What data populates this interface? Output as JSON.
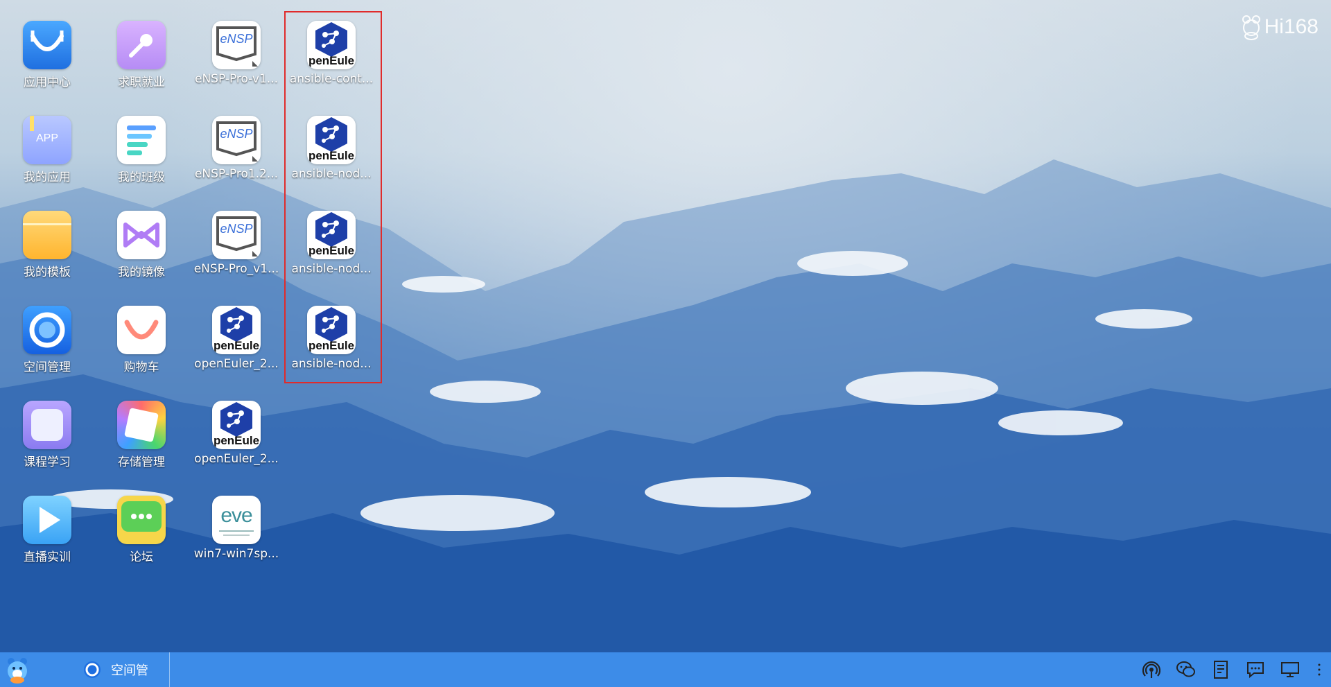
{
  "brand": "Hi168",
  "icons": [
    {
      "label": "应用中心",
      "icon": "store-bag-icon"
    },
    {
      "label": "我的应用",
      "icon": "app-folder-icon",
      "badge": "APP"
    },
    {
      "label": "我的模板",
      "icon": "folder-icon"
    },
    {
      "label": "空间管理",
      "icon": "space-ring-icon"
    },
    {
      "label": "课程学习",
      "icon": "course-icon"
    },
    {
      "label": "直播实训",
      "icon": "play-icon"
    },
    {
      "label": "求职就业",
      "icon": "key-icon"
    },
    {
      "label": "我的班级",
      "icon": "class-list-icon"
    },
    {
      "label": "我的镜像",
      "icon": "mirror-icon"
    },
    {
      "label": "购物车",
      "icon": "cart-smile-icon"
    },
    {
      "label": "存储管理",
      "icon": "storage-icon"
    },
    {
      "label": "论坛",
      "icon": "forum-chat-icon"
    },
    {
      "label": "eNSP-Pro-v1...",
      "icon": "ensp-icon",
      "text": "eNSP"
    },
    {
      "label": "eNSP-Pro1.2...",
      "icon": "ensp-icon",
      "text": "eNSP"
    },
    {
      "label": "eNSP-Pro_v1...",
      "icon": "ensp-icon",
      "text": "eNSP"
    },
    {
      "label": "openEuler_2...",
      "icon": "openeuler-icon",
      "text": "penEule"
    },
    {
      "label": "openEuler_2...",
      "icon": "openeuler-icon",
      "text": "penEule"
    },
    {
      "label": "win7-win7sp...",
      "icon": "eve-icon",
      "text": "eve"
    },
    {
      "label": "ansible-cont...",
      "icon": "openeuler-icon",
      "text": "penEule"
    },
    {
      "label": "ansible-nod...",
      "icon": "openeuler-icon",
      "text": "penEule"
    },
    {
      "label": "ansible-nod...",
      "icon": "openeuler-icon",
      "text": "penEule"
    },
    {
      "label": "ansible-nod...",
      "icon": "openeuler-icon",
      "text": "penEule"
    }
  ],
  "taskbar": {
    "open_app": "空间管",
    "tray_icons": [
      "hotspot-icon",
      "wechat-icon",
      "document-icon",
      "chat-icon",
      "monitor-icon",
      "more-icon"
    ]
  },
  "colors": {
    "taskbar": "#3d8ce8",
    "selection": "#e02b2b",
    "openeuler_blue": "#1e3fa8"
  }
}
